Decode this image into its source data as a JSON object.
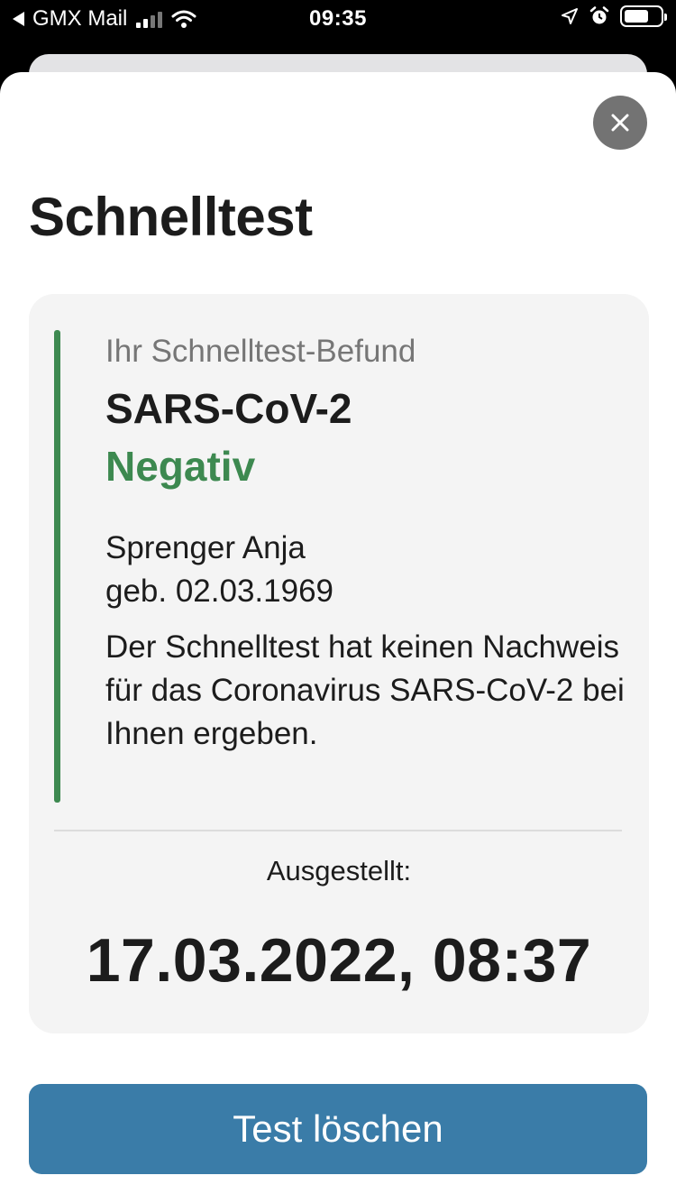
{
  "status_bar": {
    "back_app": "GMX Mail",
    "time": "09:35",
    "icons": [
      "back-arrow-icon",
      "signal-icon",
      "wifi-icon",
      "location-icon",
      "alarm-icon",
      "battery-icon"
    ]
  },
  "sheet": {
    "title": "Schnelltest",
    "close_icon": "close-icon"
  },
  "result": {
    "subtitle": "Ihr Schnelltest-Befund",
    "test_name": "SARS-CoV-2",
    "status": "Negativ",
    "person_name": "Sprenger Anja",
    "birth_date": "geb. 02.03.1969",
    "description": "Der Schnelltest hat keinen Nachweis für das Coronavirus SARS-CoV-2 bei Ihnen ergeben.",
    "issued_label": "Ausgestellt:",
    "issued_value": "17.03.2022, 08:37"
  },
  "actions": {
    "delete_label": "Test löschen"
  },
  "colors": {
    "accent_green": "#3d8950",
    "button_blue": "#3a7ca8",
    "card_bg": "#f4f4f4"
  }
}
